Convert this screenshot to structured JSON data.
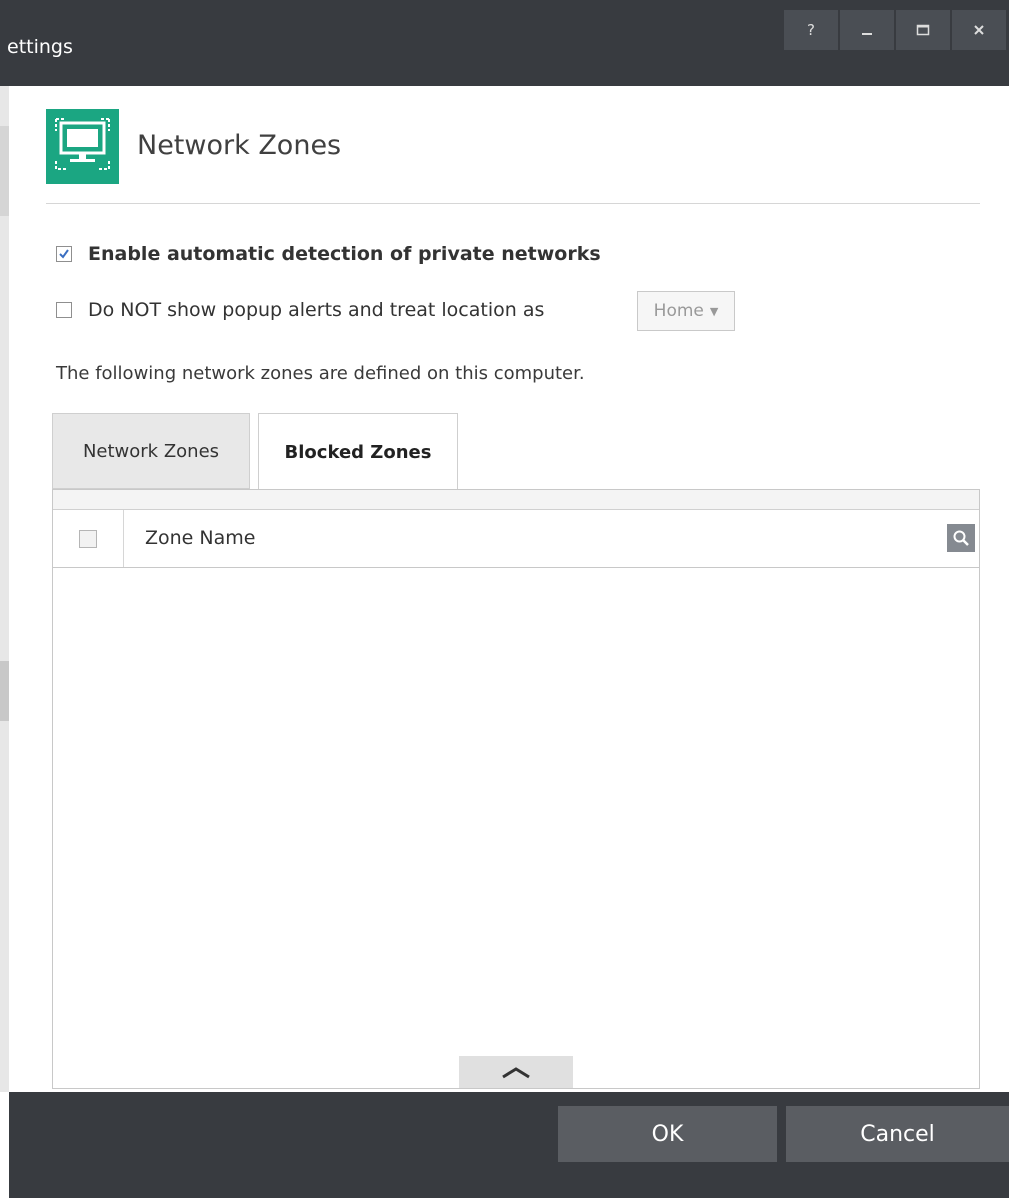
{
  "window": {
    "title": "ettings",
    "controls": {
      "help": "?",
      "minimize_icon": "minimize-icon",
      "maximize_icon": "maximize-icon",
      "close_icon": "close-icon"
    }
  },
  "header": {
    "title": "Network Zones",
    "icon": "network-zones-icon",
    "icon_color": "#1ba682"
  },
  "options": {
    "auto_detect": {
      "label": "Enable automatic detection of private networks",
      "checked": true
    },
    "no_popup": {
      "label": "Do NOT show popup alerts and treat location as",
      "checked": false
    },
    "location_select": {
      "value": "Home"
    }
  },
  "description": "The following network zones are defined on this computer.",
  "tabs": [
    {
      "label": "Network Zones",
      "active": false
    },
    {
      "label": "Blocked Zones",
      "active": true
    }
  ],
  "table": {
    "columns": [
      "Zone Name"
    ],
    "rows": []
  },
  "footer": {
    "ok_label": "OK",
    "cancel_label": "Cancel"
  },
  "colors": {
    "titlebar": "#383b40",
    "accent": "#1ba682",
    "footer_button": "#5a5d62"
  }
}
